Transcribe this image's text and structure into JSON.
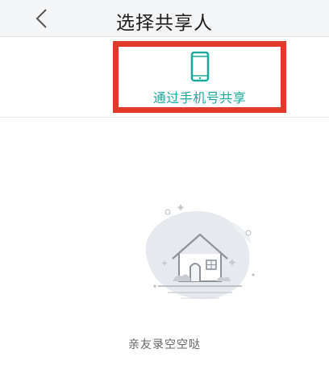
{
  "header": {
    "title": "选择共享人",
    "back_icon": "chevron-left-icon"
  },
  "share": {
    "label": "通过手机号共享",
    "icon": "phone-icon",
    "accent_color": "#19a89c",
    "highlight_color": "#e23a2a"
  },
  "empty_state": {
    "illustration": "empty-house-icon",
    "text": "亲友录空空哒"
  }
}
